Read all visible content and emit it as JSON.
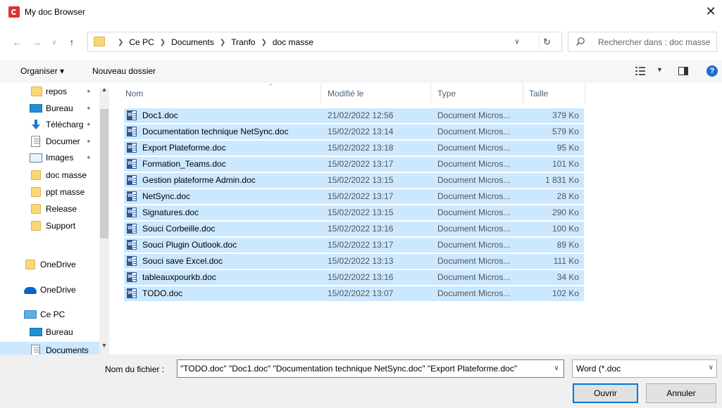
{
  "window": {
    "title": "My doc Browser",
    "close_label": "✕"
  },
  "address": {
    "crumbs": [
      "Ce PC",
      "Documents",
      "Tranfo",
      "doc masse"
    ],
    "search_placeholder": "Rechercher dans : doc masse"
  },
  "toolbar": {
    "organiser_label": "Organiser ▾",
    "new_folder_label": "Nouveau dossier",
    "help_label": "?"
  },
  "sidebar": {
    "items": [
      {
        "label": "repos",
        "icon": "folder-icon",
        "pinned": true
      },
      {
        "label": "Bureau",
        "icon": "desktop-icon",
        "pinned": true
      },
      {
        "label": "Télécharg",
        "icon": "download-icon",
        "pinned": true
      },
      {
        "label": "Documer",
        "icon": "documents-icon",
        "pinned": true
      },
      {
        "label": "Images",
        "icon": "images-icon",
        "pinned": true
      },
      {
        "label": "doc masse",
        "icon": "folder-icon",
        "pinned": false
      },
      {
        "label": "ppt masse",
        "icon": "folder-icon",
        "pinned": false
      },
      {
        "label": "Release",
        "icon": "folder-icon",
        "pinned": false
      },
      {
        "label": "Support",
        "icon": "folder-icon",
        "pinned": false
      },
      {
        "label": "OneDrive",
        "icon": "folder-icon",
        "pinned": false
      },
      {
        "label": "OneDrive",
        "icon": "cloud-icon",
        "pinned": false
      },
      {
        "label": "Ce PC",
        "icon": "computer-icon",
        "pinned": false
      },
      {
        "label": "Bureau",
        "icon": "desktop-icon",
        "pinned": false
      },
      {
        "label": "Documents",
        "icon": "documents-icon",
        "pinned": false,
        "selected": true
      }
    ]
  },
  "filelist": {
    "columns": [
      "Nom",
      "Modifié le",
      "Type",
      "Taille"
    ],
    "rows": [
      {
        "name": "Doc1.doc",
        "date": "21/02/2022 12:56",
        "type": "Document Micros...",
        "size": "379 Ko"
      },
      {
        "name": "Documentation technique NetSync.doc",
        "date": "15/02/2022 13:14",
        "type": "Document Micros...",
        "size": "579 Ko"
      },
      {
        "name": "Export Plateforme.doc",
        "date": "15/02/2022 13:18",
        "type": "Document Micros...",
        "size": "95 Ko"
      },
      {
        "name": "Formation_Teams.doc",
        "date": "15/02/2022 13:17",
        "type": "Document Micros...",
        "size": "101 Ko"
      },
      {
        "name": "Gestion plateforme Admin.doc",
        "date": "15/02/2022 13:15",
        "type": "Document Micros...",
        "size": "1 831 Ko"
      },
      {
        "name": "NetSync.doc",
        "date": "15/02/2022 13:17",
        "type": "Document Micros...",
        "size": "28 Ko"
      },
      {
        "name": "Signatures.doc",
        "date": "15/02/2022 13:15",
        "type": "Document Micros...",
        "size": "290 Ko"
      },
      {
        "name": "Souci Corbeille.doc",
        "date": "15/02/2022 13:16",
        "type": "Document Micros...",
        "size": "100 Ko"
      },
      {
        "name": "Souci Plugin Outlook.doc",
        "date": "15/02/2022 13:17",
        "type": "Document Micros...",
        "size": "89 Ko"
      },
      {
        "name": "Souci save Excel.doc",
        "date": "15/02/2022 13:13",
        "type": "Document Micros...",
        "size": "111 Ko"
      },
      {
        "name": "tableauxpourkb.doc",
        "date": "15/02/2022 13:16",
        "type": "Document Micros...",
        "size": "34 Ko"
      },
      {
        "name": "TODO.doc",
        "date": "15/02/2022 13:07",
        "type": "Document Micros...",
        "size": "102 Ko"
      }
    ]
  },
  "bottom": {
    "filename_label": "Nom du fichier :",
    "filename_value": "\"TODO.doc\" \"Doc1.doc\" \"Documentation technique NetSync.doc\" \"Export Plateforme.doc\"",
    "filetype_value": "Word (*.doc",
    "open_label": "Ouvrir",
    "cancel_label": "Annuler"
  },
  "colors": {
    "selection": "#cce8ff",
    "accent": "#0078d7",
    "app_icon": "#e03232"
  }
}
